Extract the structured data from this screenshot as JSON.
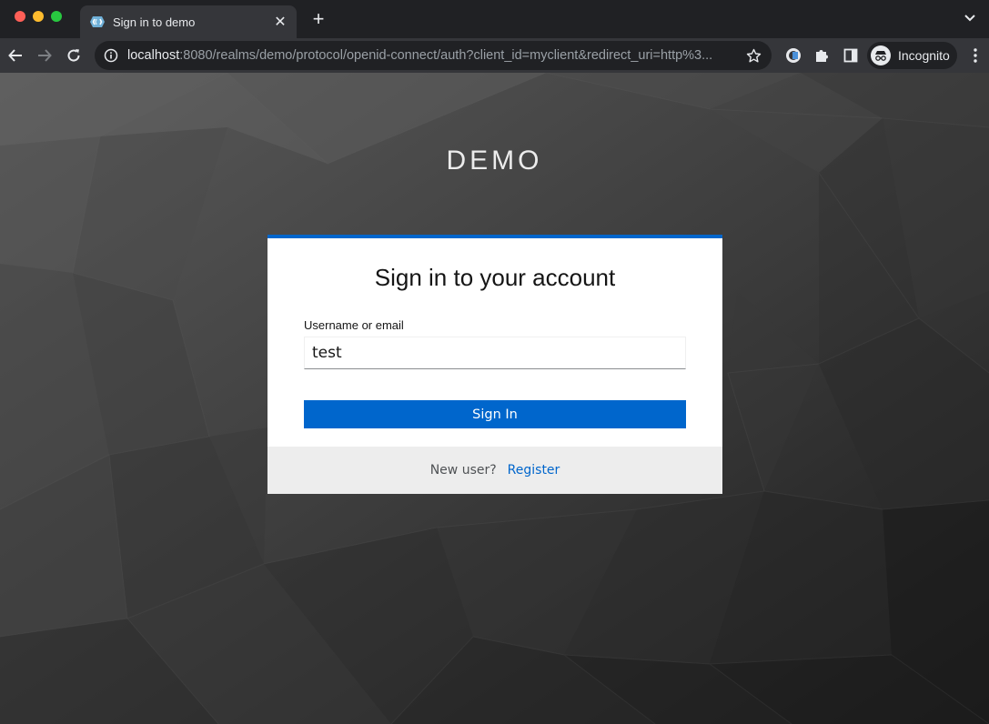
{
  "browser": {
    "tab_title": "Sign in to demo",
    "url_host": "localhost",
    "url_rest": ":8080/realms/demo/protocol/openid-connect/auth?client_id=myclient&redirect_uri=http%3...",
    "profile_label": "Incognito"
  },
  "page": {
    "realm_title": "DEMO",
    "card_title": "Sign in to your account",
    "username_label": "Username or email",
    "username_value": "test",
    "sign_in_label": "Sign In",
    "new_user_text": "New user?",
    "register_label": "Register"
  },
  "colors": {
    "accent": "#0066cc",
    "footer_bg": "#ededed",
    "page_bg": "#3a3a3a"
  }
}
